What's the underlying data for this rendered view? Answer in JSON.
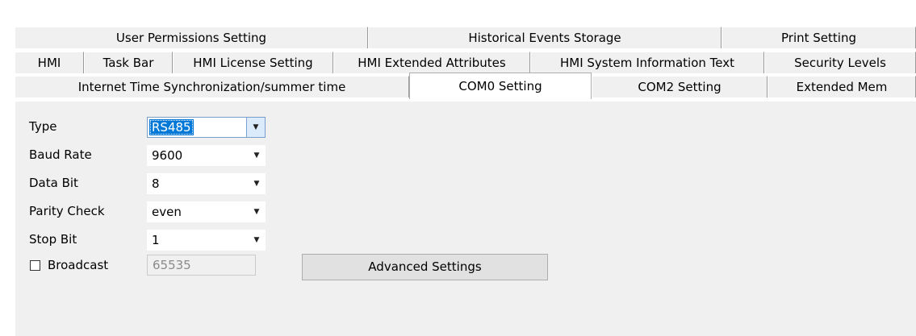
{
  "tabs": {
    "row1": [
      "User Permissions Setting",
      "Historical Events Storage",
      "Print Setting"
    ],
    "row2": [
      "HMI",
      "Task Bar",
      "HMI License Setting",
      "HMI Extended Attributes",
      "HMI System Information Text",
      "Security Levels"
    ],
    "row3": [
      "Internet Time Synchronization/summer time",
      "COM0 Setting",
      "COM2 Setting",
      "Extended Mem"
    ],
    "active": "COM0 Setting"
  },
  "form": {
    "type_label": "Type",
    "type_value": "RS485",
    "baud_label": "Baud Rate",
    "baud_value": "9600",
    "databit_label": "Data Bit",
    "databit_value": "8",
    "parity_label": "Parity Check",
    "parity_value": "even",
    "stopbit_label": "Stop Bit",
    "stopbit_value": "1",
    "broadcast_label": "Broadcast",
    "broadcast_checked": false,
    "broadcast_value": "65535",
    "advanced_button": "Advanced Settings"
  },
  "icons": {
    "dropdown": "chevron-down-icon",
    "checkbox": "checkbox-unchecked-icon"
  },
  "colors": {
    "panel": "#f0f0f0",
    "selection": "#0078d7",
    "focus_arrow_bg": "#dcebfc"
  }
}
